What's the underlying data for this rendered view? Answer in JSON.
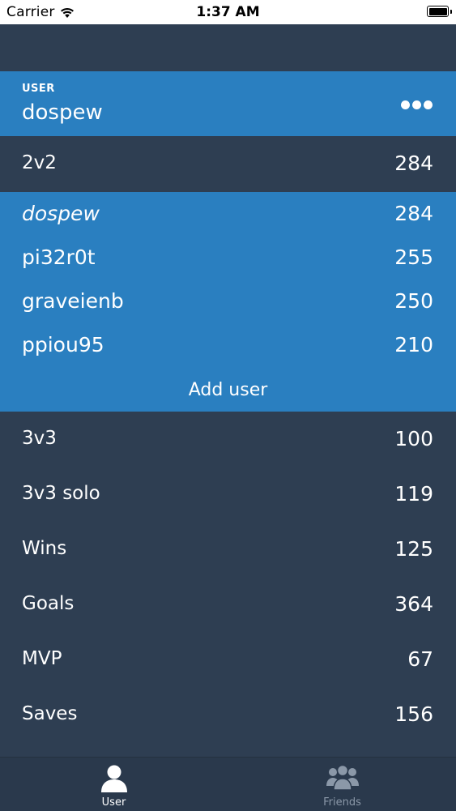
{
  "status_bar": {
    "carrier": "Carrier",
    "time": "1:37 AM"
  },
  "user_header": {
    "label": "USER",
    "username": "dospew",
    "more_icon": "more-dots-icon"
  },
  "mode_2v2": {
    "label": "2v2",
    "value": "284"
  },
  "players": [
    {
      "name": "dospew",
      "value": "284"
    },
    {
      "name": "pi32r0t",
      "value": "255"
    },
    {
      "name": "graveienb",
      "value": "250"
    },
    {
      "name": "ppiou95",
      "value": "210"
    }
  ],
  "add_user_label": "Add user",
  "stats": [
    {
      "label": "3v3",
      "value": "100"
    },
    {
      "label": "3v3 solo",
      "value": "119"
    },
    {
      "label": "Wins",
      "value": "125"
    },
    {
      "label": "Goals",
      "value": "364"
    },
    {
      "label": "MVP",
      "value": "67"
    },
    {
      "label": "Saves",
      "value": "156"
    }
  ],
  "tabs": [
    {
      "label": "User",
      "icon": "user-icon",
      "selected": true
    },
    {
      "label": "Friends",
      "icon": "friends-icon",
      "selected": false
    }
  ],
  "colors": {
    "accent": "#2a7fc0",
    "background": "#2e3e52",
    "tabbar": "#2a394c",
    "inactive_tab": "#8b98a8"
  }
}
